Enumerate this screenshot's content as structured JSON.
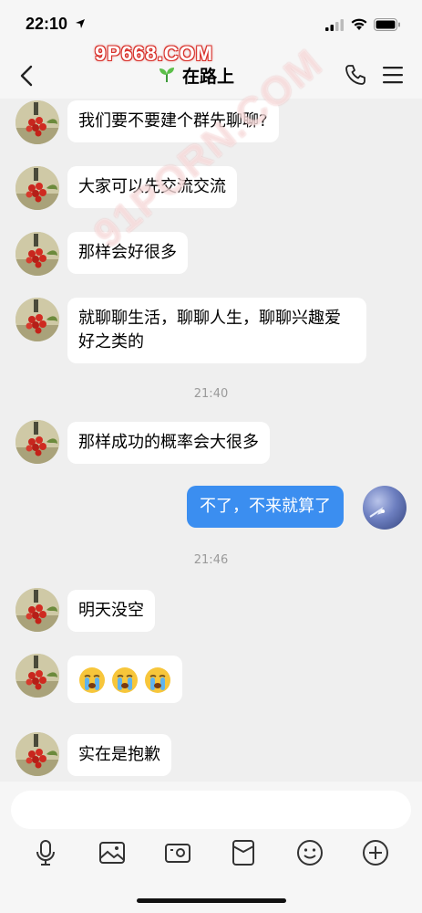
{
  "status": {
    "time": "22:10"
  },
  "watermarks": {
    "top": "9P668.COM",
    "diagonal": "91PORN.COM"
  },
  "header": {
    "title": "在路上"
  },
  "messages": [
    {
      "from": "other",
      "text": "我们要不要建个群先聊聊?"
    },
    {
      "from": "other",
      "text": "大家可以先交流交流"
    },
    {
      "from": "other",
      "text": "那样会好很多"
    },
    {
      "from": "other",
      "text": "就聊聊生活，聊聊人生，聊聊兴趣爱好之类的"
    },
    {
      "from": "time",
      "text": "21:40"
    },
    {
      "from": "other",
      "text": "那样成功的概率会大很多"
    },
    {
      "from": "self",
      "text": "不了，不来就算了"
    },
    {
      "from": "time",
      "text": "21:46"
    },
    {
      "from": "other",
      "text": "明天没空"
    },
    {
      "from": "other",
      "text": "crying-face-emoji x3"
    },
    {
      "from": "other",
      "text": "实在是抱歉"
    }
  ],
  "input": {
    "placeholder": ""
  },
  "toolbar": [
    "microphone-icon",
    "image-icon",
    "camera-icon",
    "red-packet-icon",
    "smiley-icon",
    "add-icon"
  ]
}
